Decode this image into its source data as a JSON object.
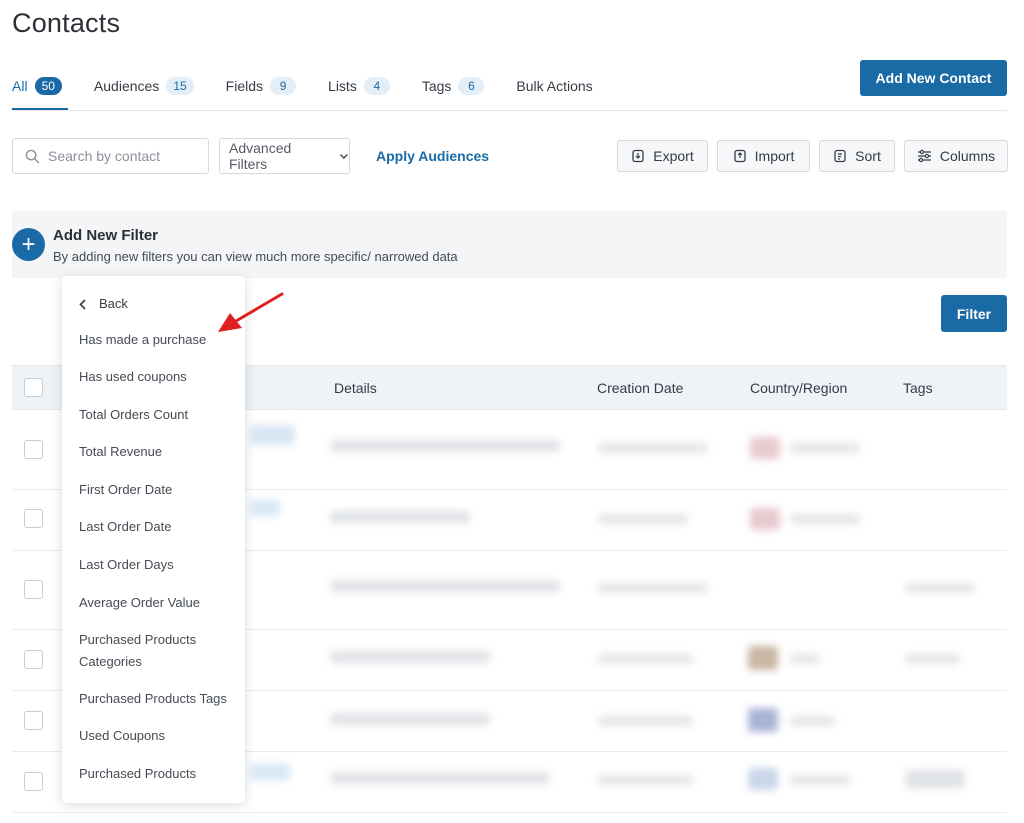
{
  "page": {
    "title": "Contacts"
  },
  "tabs": [
    {
      "label": "All",
      "count": "50"
    },
    {
      "label": "Audiences",
      "count": "15"
    },
    {
      "label": "Fields",
      "count": "9"
    },
    {
      "label": "Lists",
      "count": "4"
    },
    {
      "label": "Tags",
      "count": "6"
    },
    {
      "label": "Bulk Actions"
    }
  ],
  "header": {
    "add_contact_label": "Add New Contact"
  },
  "toolbar": {
    "search_placeholder": "Search by contact",
    "advanced_filters_label": "Advanced Filters",
    "apply_audiences_label": "Apply Audiences",
    "export_label": "Export",
    "import_label": "Import",
    "sort_label": "Sort",
    "columns_label": "Columns"
  },
  "filter_panel": {
    "title": "Add New Filter",
    "subtitle": "By adding new filters you can view much more specific/ narrowed data",
    "filter_button": "Filter"
  },
  "table": {
    "columns": [
      "Details",
      "Creation Date",
      "Country/Region",
      "Tags"
    ]
  },
  "dropdown": {
    "back_label": "Back",
    "items": [
      "Has made a purchase",
      "Has used coupons",
      "Total Orders Count",
      "Total Revenue",
      "First Order Date",
      "Last Order Date",
      "Last Order Days",
      "Average Order Value",
      "Purchased Products Categories",
      "Purchased Products Tags",
      "Used Coupons",
      "Purchased Products"
    ]
  },
  "colors": {
    "primary": "#1a6aa6",
    "arrow": "#e02020"
  }
}
